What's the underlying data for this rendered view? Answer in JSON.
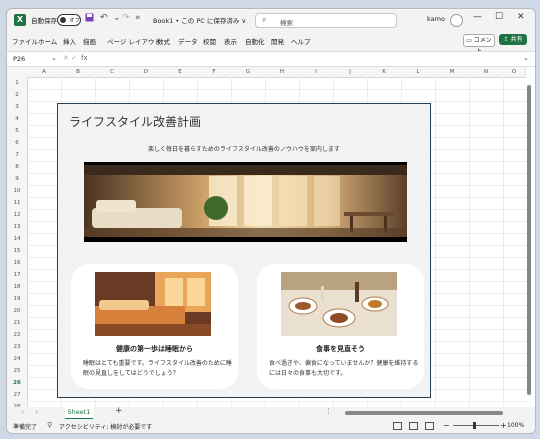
{
  "window": {
    "autosave_label": "自動保存",
    "autosave_state": "オフ",
    "doc_name": "Book1 • この PC に保存済み ∨",
    "search_placeholder": "検索",
    "user_name": "kamo",
    "controls": [
      "—",
      "☐",
      "✕"
    ]
  },
  "ribbon": {
    "tabs": [
      "ファイル",
      "ホーム",
      "挿入",
      "描画",
      "ページ レイアウト",
      "数式",
      "データ",
      "校閲",
      "表示",
      "自動化",
      "開発",
      "ヘルプ"
    ],
    "comment_button": "コメント",
    "share_button": "共有"
  },
  "formula_bar": {
    "name_box": "P26",
    "fx": "fx",
    "value": ""
  },
  "grid": {
    "columns": [
      "A",
      "B",
      "C",
      "D",
      "E",
      "F",
      "G",
      "H",
      "I",
      "J",
      "K",
      "L",
      "M",
      "N",
      "O"
    ],
    "rows": [
      "1",
      "2",
      "3",
      "4",
      "5",
      "6",
      "7",
      "8",
      "9",
      "10",
      "11",
      "12",
      "13",
      "14",
      "15",
      "16",
      "17",
      "18",
      "19",
      "20",
      "21",
      "22",
      "23",
      "24",
      "25",
      "26",
      "27",
      "28"
    ]
  },
  "content": {
    "title": "ライフスタイル改善計画",
    "subtitle": "楽しく毎日を暮らすためのライフスタイル改善のノウハウを案内します",
    "card1": {
      "title": "健康の第一歩は睡眠から",
      "body": "睡眠はとても重要です。ライフスタイル改善のために睡眠の見直しをしてはどうでしょう？"
    },
    "card2": {
      "title": "食事を見直そう",
      "body": "食べ過ぎや、偏食になっていませんか？健康を維持するには日々の食事も大切です。"
    }
  },
  "sheets": {
    "active": "Sheet1",
    "add": "+"
  },
  "status": {
    "ready": "準備完了",
    "accessibility": "アクセシビリティ: 検討が必要です",
    "zoom": "100%"
  },
  "colors": {
    "excel_green": "#1f7244",
    "panel_border": "#2a4050"
  }
}
